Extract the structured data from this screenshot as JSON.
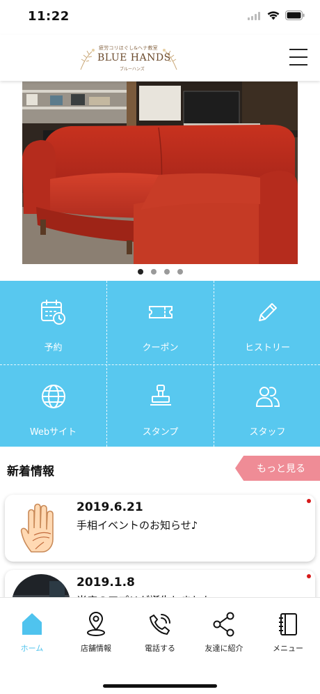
{
  "status_bar": {
    "time": "11:22",
    "icons": [
      "signal-icon",
      "wifi-icon",
      "battery-icon"
    ]
  },
  "header": {
    "logo": {
      "tagline": "疲労コリほぐし&ヘナ教室",
      "name": "BLUE HANDS",
      "sub": "ブルーハンズ"
    },
    "menu_icon": "hamburger-icon"
  },
  "carousel": {
    "slide_count": 4,
    "active_index": 0
  },
  "menu_grid": [
    {
      "label": "予約",
      "icon": "calendar-clock-icon"
    },
    {
      "label": "クーポン",
      "icon": "ticket-icon"
    },
    {
      "label": "ヒストリー",
      "icon": "pencil-icon"
    },
    {
      "label": "Webサイト",
      "icon": "globe-icon"
    },
    {
      "label": "スタンプ",
      "icon": "stamp-icon"
    },
    {
      "label": "スタッフ",
      "icon": "people-icon"
    }
  ],
  "news": {
    "title": "新着情報",
    "more_label": "もっと見る",
    "items": [
      {
        "date": "2019.6.21",
        "text": "手相イベントのお知らせ♪",
        "unread": true
      },
      {
        "date": "2019.1.8",
        "text": "当店のアプリが誕生しました",
        "unread": true
      }
    ]
  },
  "tabbar": [
    {
      "label": "ホーム",
      "icon": "home-icon",
      "active": true
    },
    {
      "label": "店舗情報",
      "icon": "map-pin-icon",
      "active": false
    },
    {
      "label": "電話する",
      "icon": "phone-icon",
      "active": false
    },
    {
      "label": "友達に紹介",
      "icon": "share-icon",
      "active": false
    },
    {
      "label": "メニュー",
      "icon": "book-icon",
      "active": false
    }
  ],
  "colors": {
    "accent": "#58c8ef",
    "tab_active": "#4fc3ee",
    "more_button": "#ef8c96",
    "unread": "#d61a1a"
  }
}
